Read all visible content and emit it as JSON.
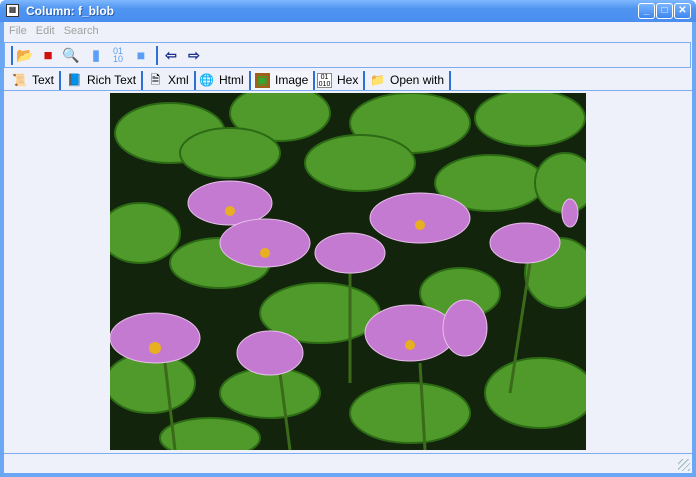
{
  "window": {
    "title": "Column: f_blob",
    "buttons": [
      "minimize",
      "maximize",
      "close"
    ]
  },
  "menu": [
    "File",
    "Edit",
    "Search"
  ],
  "toolbar": [
    "open",
    "save",
    "find",
    "new",
    "replace",
    "lock",
    "back",
    "forward"
  ],
  "tabs": [
    {
      "label": "Text",
      "icon": "text-icon"
    },
    {
      "label": "Rich Text",
      "icon": "rich-text-icon"
    },
    {
      "label": "Xml",
      "icon": "xml-icon"
    },
    {
      "label": "Html",
      "icon": "html-icon"
    },
    {
      "label": "Image",
      "icon": "image-icon",
      "active": true
    },
    {
      "label": "Hex",
      "icon": "hex-icon"
    },
    {
      "label": "Open with",
      "icon": "open-with-icon"
    }
  ],
  "colors": {
    "title": "#4a8ef0",
    "accent": "#2e6fd8",
    "background": "#eef1f9"
  }
}
